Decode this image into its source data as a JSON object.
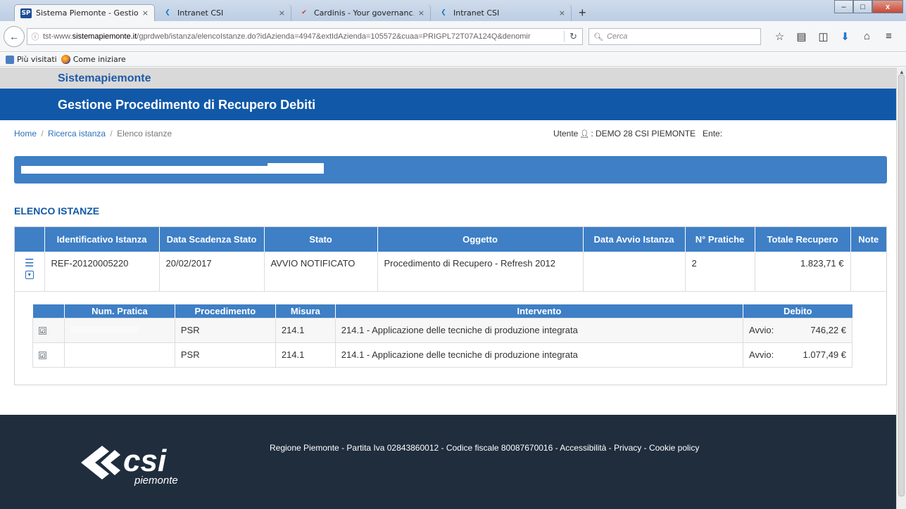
{
  "browser": {
    "tabs": [
      {
        "title": "Sistema Piemonte - Gestio...",
        "favicon": "SP",
        "active": true
      },
      {
        "title": "Intranet CSI",
        "favicon": "csi-logo",
        "active": false
      },
      {
        "title": "Cardinis - Your governanc...",
        "favicon": "cardinis-logo",
        "active": false
      },
      {
        "title": "Intranet CSI",
        "favicon": "csi-logo",
        "active": false
      }
    ],
    "tab_close": "×",
    "new_tab": "+",
    "window_controls": {
      "minimize": "–",
      "maximize": "□",
      "close": "x"
    },
    "url_prefix": "tst-www.",
    "url_domain": "sistemapiemonte.it",
    "url_path": "/gprdweb/istanza/elencoIstanze.do?idAzienda=4947&extIdAzienda=105572&cuaa=PRIGPL72T07A124Q&denomir",
    "search_placeholder": "Cerca",
    "bookmarks": [
      "Più visitati",
      "Come iniziare"
    ]
  },
  "app": {
    "brand": "Sistemapiemonte",
    "title": "Gestione Procedimento di Recupero Debiti"
  },
  "breadcrumb": {
    "home": "Home",
    "search": "Ricerca istanza",
    "current": "Elenco istanze",
    "separator": "/"
  },
  "user": {
    "label": "Utente",
    "name": ": DEMO 28 CSI PIEMONTE",
    "ente_label": "Ente:"
  },
  "section": {
    "title": "ELENCO ISTANZE"
  },
  "istanze_table": {
    "columns": [
      "",
      "Identificativo Istanza",
      "Data Scadenza Stato",
      "Stato",
      "Oggetto",
      "Data Avvio Istanza",
      "N° Pratiche",
      "Totale Recupero",
      "Note"
    ],
    "rows": [
      {
        "id": "REF-20120005220",
        "data_scadenza": "20/02/2017",
        "stato": "AVVIO NOTIFICATO",
        "oggetto": "Procedimento di Recupero - Refresh 2012",
        "data_avvio": "",
        "n_pratiche": "2",
        "totale": "1.823,71 €",
        "note": ""
      }
    ]
  },
  "pratiche_table": {
    "columns": [
      "",
      "Num. Pratica",
      "Procedimento",
      "Misura",
      "Intervento",
      "Debito"
    ],
    "rows": [
      {
        "checked": "☑",
        "num": "",
        "procedimento": "PSR",
        "misura": "214.1",
        "intervento": "214.1 - Applicazione delle tecniche di produzione integrata",
        "debito_label": "Avvio:",
        "debito": "746,22 €"
      },
      {
        "checked": "☑",
        "num": "",
        "procedimento": "PSR",
        "misura": "214.1",
        "intervento": "214.1 - Applicazione delle tecniche di produzione integrata",
        "debito_label": "Avvio:",
        "debito": "1.077,49 €"
      }
    ]
  },
  "footer": {
    "logo_text": "csi",
    "logo_sub": "piemonte",
    "text": "Regione Piemonte - Partita Iva 02843860012 - Codice fiscale 80087670016 - Accessibilità - Privacy - Cookie policy"
  }
}
